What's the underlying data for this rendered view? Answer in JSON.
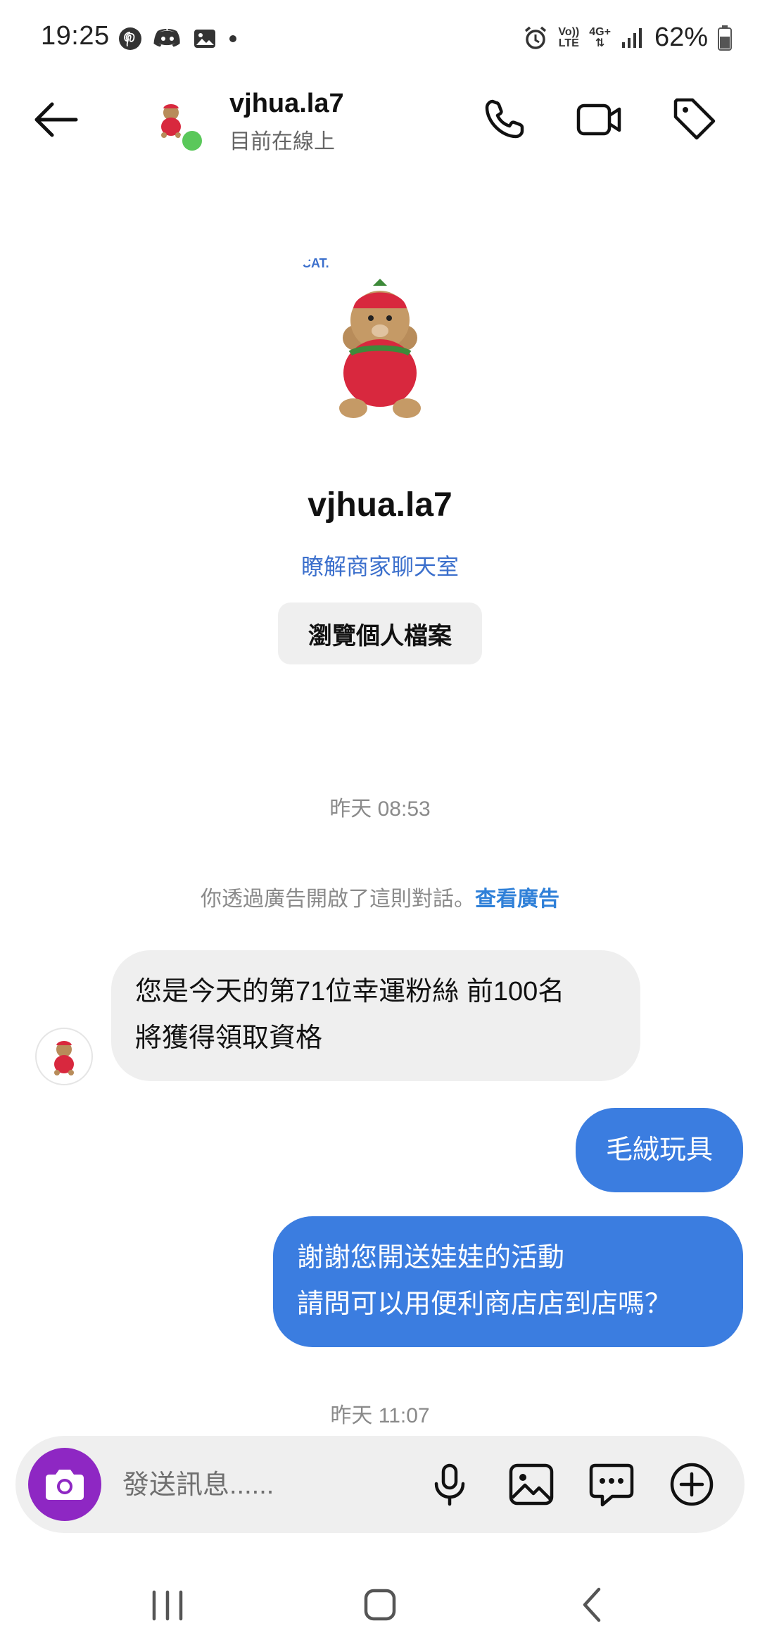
{
  "status_bar": {
    "time": "19:25",
    "battery": "62%",
    "network_top": "Vo))",
    "network_bottom": "LTE",
    "data_type": "4G+"
  },
  "header": {
    "username": "vjhua.la7",
    "status": "目前在線上",
    "icons": [
      "back-arrow-icon",
      "phone-icon",
      "video-camera-icon",
      "tag-icon"
    ]
  },
  "profile": {
    "name": "vjhua.la7",
    "business_link": "瞭解商家聊天室",
    "view_profile": "瀏覽個人檔案"
  },
  "conversation": {
    "timestamp_1": "昨天 08:53",
    "ad_notice": "你透過廣告開啟了這則對話。",
    "ad_link": "查看廣告",
    "received_1": {
      "line1": "您是今天的第71位幸運粉絲 前100名",
      "line2": "將獲得領取資格"
    },
    "sent_1": "毛絨玩具",
    "sent_2": {
      "line1": "謝謝您開送娃娃的活動",
      "line2": "請問可以用便利商店店到店嗎？"
    },
    "timestamp_2": "昨天 11:07"
  },
  "composer": {
    "placeholder": "發送訊息......",
    "icons": [
      "camera-icon",
      "microphone-icon",
      "image-icon",
      "chat-bubble-icon",
      "plus-circle-icon"
    ]
  },
  "colors": {
    "accent_blue": "#3b7de0",
    "link_blue": "#3b6fcc",
    "camera_purple": "#8e27c3",
    "online_green": "#5ac85a"
  }
}
